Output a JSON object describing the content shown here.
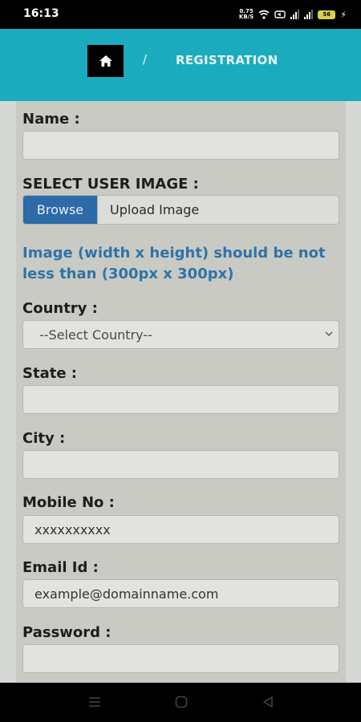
{
  "status_bar": {
    "time": "16:13",
    "net_speed_value": "0.75",
    "net_speed_unit": "KB/S",
    "battery_level": "56"
  },
  "header": {
    "home_icon": "home-icon",
    "separator": "/",
    "current_page": "REGISTRATION",
    "background_color": "#1aacbe"
  },
  "form": {
    "name_label": "Name :",
    "name_value": "",
    "image_label": "SELECT USER IMAGE :",
    "browse_label": "Browse",
    "upload_placeholder": "Upload Image",
    "image_hint": "Image (width x height) should be not less than (300px x 300px)",
    "country_label": "Country :",
    "country_selected": "--Select Country--",
    "state_label": "State :",
    "state_value": "",
    "city_label": "City :",
    "city_value": "",
    "mobile_label": "Mobile No :",
    "mobile_placeholder": "xxxxxxxxxx",
    "email_label": "Email Id :",
    "email_placeholder": "example@domainname.com",
    "password_label": "Password :",
    "password_value": ""
  },
  "nav_bar": {
    "menu_icon": "menu-icon",
    "home_icon": "home-circle-icon",
    "back_icon": "back-triangle-icon"
  }
}
